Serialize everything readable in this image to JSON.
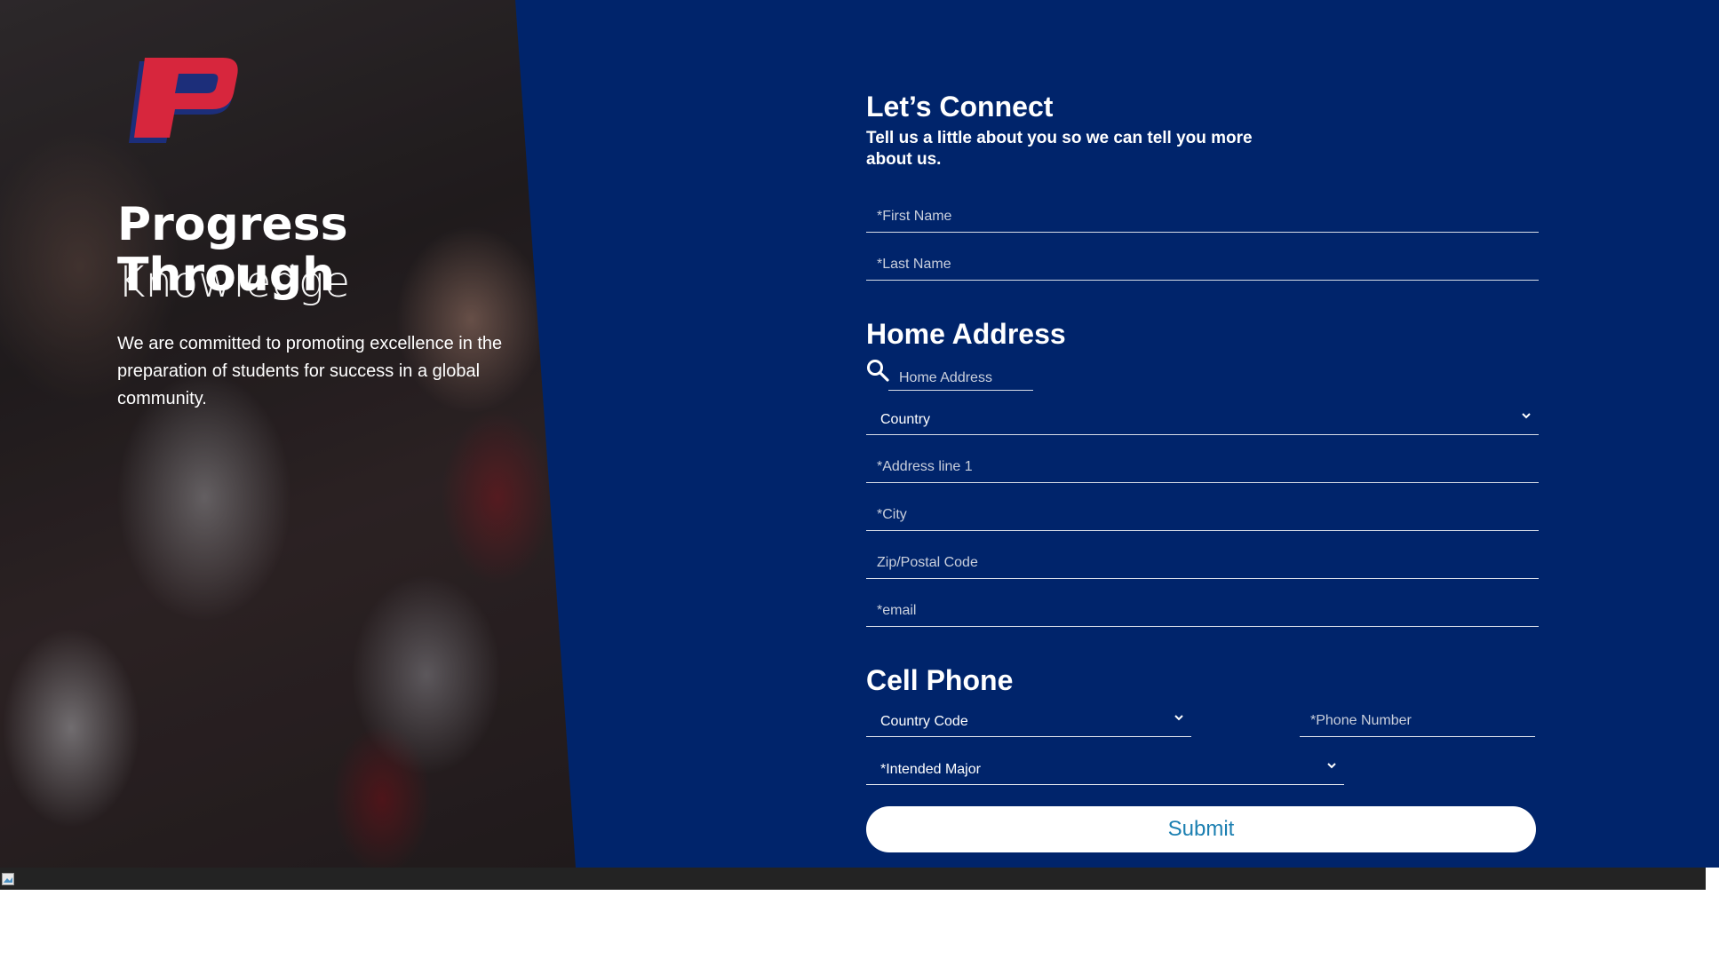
{
  "hero": {
    "title": "Progress Through",
    "subtitle": "Knowledge",
    "text": "We are committed to promoting excellence in the preparation of students for success in a global community."
  },
  "form": {
    "heading": "Let’s Connect",
    "lead": "Tell us a little about you so we can tell you more about us.",
    "first_name_placeholder": "*First Name",
    "last_name_placeholder": "*Last Name",
    "home_address_heading": "Home Address",
    "home_address_search_placeholder": "Home Address",
    "country_value": "Country",
    "address_line1_placeholder": "*Address line 1",
    "city_placeholder": "*City",
    "zip_placeholder": "Zip/Postal Code",
    "email_placeholder": "*email",
    "cell_phone_heading": "Cell Phone",
    "country_code_value": "Country Code",
    "phone_placeholder": "*Phone Number",
    "intended_major_value": "*Intended Major",
    "submit_label": "Submit"
  },
  "colors": {
    "panel_blue": "#00246b",
    "logo_red": "#d7263d",
    "logo_blue": "#1c2e7a",
    "submit_text": "#1b7fb1",
    "footer": "#232323"
  },
  "icons": {
    "search": "search-icon",
    "chevron": "chevron-down-icon",
    "logo": "p-logo",
    "broken_image": "broken-image-icon"
  }
}
